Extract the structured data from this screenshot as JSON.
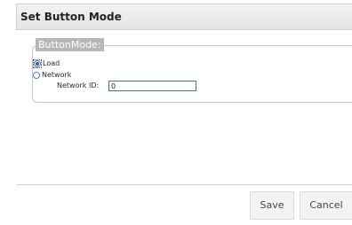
{
  "dialog": {
    "title": "Set Button Mode"
  },
  "button_mode": {
    "legend": "ButtonMode:",
    "options": [
      {
        "label": "Load",
        "selected": true
      },
      {
        "label": "Network",
        "selected": false
      }
    ],
    "network_id": {
      "label": "Network ID:",
      "value": "0"
    }
  },
  "footer": {
    "save_label": "Save",
    "cancel_label": "Cancel"
  },
  "colors": {
    "legend_bg": "#b7b7b7",
    "input_border": "#3c6fc2",
    "radio_accent": "#2b5ea8"
  }
}
